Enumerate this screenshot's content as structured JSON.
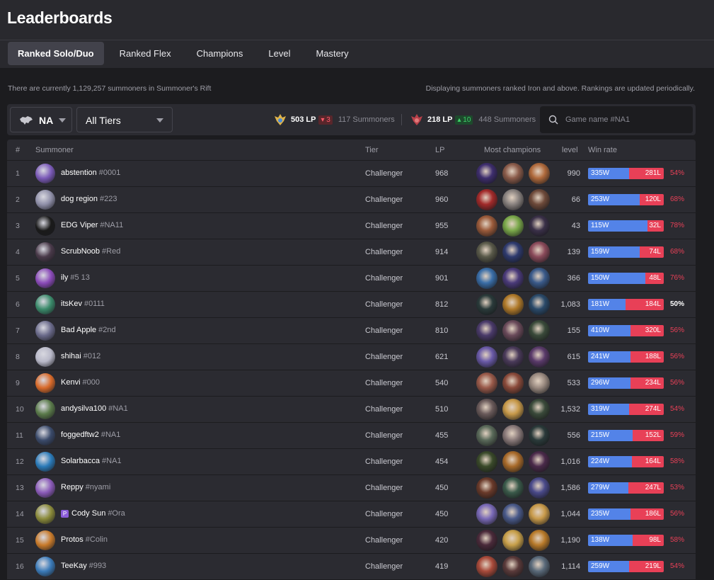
{
  "page": {
    "title": "Leaderboards"
  },
  "tabs": [
    {
      "label": "Ranked Solo/Duo",
      "active": true
    },
    {
      "label": "Ranked Flex",
      "active": false
    },
    {
      "label": "Champions",
      "active": false
    },
    {
      "label": "Level",
      "active": false
    },
    {
      "label": "Mastery",
      "active": false
    }
  ],
  "info": {
    "count_text": "There are currently 1,129,257 summoners in Summoner's Rift",
    "note": "Displaying summoners ranked Iron and above. Rankings are updated periodically."
  },
  "filters": {
    "region": "NA",
    "tier": "All Tiers",
    "search_placeholder": "Game name #NA1",
    "cutoffs": [
      {
        "lp": "503 LP",
        "delta": "3",
        "direction": "down",
        "summoners": "117 Summoners",
        "icon": "challenger-emblem-icon"
      },
      {
        "lp": "218 LP",
        "delta": "10",
        "direction": "up",
        "summoners": "448 Summoners",
        "icon": "grandmaster-emblem-icon"
      }
    ]
  },
  "table": {
    "headers": {
      "rank": "#",
      "summoner": "Summoner",
      "tier": "Tier",
      "lp": "LP",
      "champions": "Most champions",
      "level": "level",
      "winrate": "Win rate"
    },
    "rows": [
      {
        "rank": "1",
        "name": "abstention",
        "tag": "#0001",
        "tier": "Challenger",
        "lp": "968",
        "level": "990",
        "wins": "335W",
        "losses": "281L",
        "pct": "54%",
        "avatar_color": "#7b5ab8",
        "champs": [
          "#3e2e6e",
          "#8a5b4a",
          "#b06a3c"
        ]
      },
      {
        "rank": "2",
        "name": "dog region",
        "tag": "#223",
        "tier": "Challenger",
        "lp": "960",
        "level": "66",
        "wins": "253W",
        "losses": "120L",
        "pct": "68%",
        "avatar_color": "#8f8fa8",
        "champs": [
          "#a22a2a",
          "#8a8380",
          "#6e4a3a"
        ]
      },
      {
        "rank": "3",
        "name": "EDG Viper",
        "tag": "#NA11",
        "tier": "Challenger",
        "lp": "955",
        "level": "43",
        "wins": "115W",
        "losses": "32L",
        "pct": "78%",
        "avatar_color": "#1a1a1a",
        "champs": [
          "#9a5a3a",
          "#7aa84a",
          "#3a3048"
        ]
      },
      {
        "rank": "4",
        "name": "ScrubNoob",
        "tag": "#Red",
        "tier": "Challenger",
        "lp": "914",
        "level": "139",
        "wins": "159W",
        "losses": "74L",
        "pct": "68%",
        "avatar_color": "#4a3a4a",
        "champs": [
          "#5a5a4a",
          "#2e3a6e",
          "#8a4a5a"
        ]
      },
      {
        "rank": "5",
        "name": "ily",
        "tag": "#5 13",
        "tier": "Challenger",
        "lp": "901",
        "level": "366",
        "wins": "150W",
        "losses": "48L",
        "pct": "76%",
        "avatar_color": "#8a4ab8",
        "champs": [
          "#3a6ea8",
          "#4a3a7a",
          "#3a5a8a"
        ]
      },
      {
        "rank": "6",
        "name": "itsKev",
        "tag": "#0111",
        "tier": "Challenger",
        "lp": "812",
        "level": "1,083",
        "wins": "181W",
        "losses": "184L",
        "pct": "50%",
        "avatar_color": "#3a8a6a",
        "champs": [
          "#2a3a3a",
          "#b07a2a",
          "#2a4a6a"
        ]
      },
      {
        "rank": "7",
        "name": "Bad Apple",
        "tag": "#2nd",
        "tier": "Challenger",
        "lp": "810",
        "level": "155",
        "wins": "410W",
        "losses": "320L",
        "pct": "56%",
        "avatar_color": "#6a6a8a",
        "champs": [
          "#4a3a6a",
          "#6a4a5a",
          "#3a4a3a"
        ]
      },
      {
        "rank": "8",
        "name": "shihai",
        "tag": "#012",
        "tier": "Challenger",
        "lp": "621",
        "level": "615",
        "wins": "241W",
        "losses": "188L",
        "pct": "56%",
        "avatar_color": "#b8b8c8",
        "champs": [
          "#6a5aa8",
          "#4a3a5a",
          "#5a3a6a"
        ]
      },
      {
        "rank": "9",
        "name": "Kenvi",
        "tag": "#000",
        "tier": "Challenger",
        "lp": "540",
        "level": "533",
        "wins": "296W",
        "losses": "234L",
        "pct": "56%",
        "avatar_color": "#d86a2a",
        "champs": [
          "#9a5a4a",
          "#8a4a3a",
          "#9a8a80"
        ]
      },
      {
        "rank": "10",
        "name": "andysilva100",
        "tag": "#NA1",
        "tier": "Challenger",
        "lp": "510",
        "level": "1,532",
        "wins": "319W",
        "losses": "274L",
        "pct": "54%",
        "avatar_color": "#5a7a4a",
        "champs": [
          "#6a5a5a",
          "#c89a4a",
          "#3a4a3a"
        ]
      },
      {
        "rank": "11",
        "name": "foggedftw2",
        "tag": "#NA1",
        "tier": "Challenger",
        "lp": "455",
        "level": "556",
        "wins": "215W",
        "losses": "152L",
        "pct": "59%",
        "avatar_color": "#3a4a6a",
        "champs": [
          "#5a6a5a",
          "#8a7a7a",
          "#2a3a3a"
        ]
      },
      {
        "rank": "12",
        "name": "Solarbacca",
        "tag": "#NA1",
        "tier": "Challenger",
        "lp": "454",
        "level": "1,016",
        "wins": "224W",
        "losses": "164L",
        "pct": "58%",
        "avatar_color": "#2a7ab8",
        "champs": [
          "#3a4a2a",
          "#a86a2a",
          "#4a2a4a"
        ]
      },
      {
        "rank": "13",
        "name": "Reppy",
        "tag": "#nyami",
        "tier": "Challenger",
        "lp": "450",
        "level": "1,586",
        "wins": "279W",
        "losses": "247L",
        "pct": "53%",
        "avatar_color": "#8a5ab8",
        "champs": [
          "#6a3a2a",
          "#3a5a4a",
          "#4a4a8a"
        ]
      },
      {
        "rank": "14",
        "name": "Cody Sun",
        "tag": "#Ora",
        "tier": "Challenger",
        "lp": "450",
        "level": "1,044",
        "wins": "235W",
        "losses": "186L",
        "pct": "56%",
        "avatar_color": "#8a8a3a",
        "badge": "P",
        "champs": [
          "#7a6ab8",
          "#4a5a8a",
          "#c89a4a"
        ]
      },
      {
        "rank": "15",
        "name": "Protos",
        "tag": "#Colin",
        "tier": "Challenger",
        "lp": "420",
        "level": "1,190",
        "wins": "138W",
        "losses": "98L",
        "pct": "58%",
        "avatar_color": "#c87a2a",
        "champs": [
          "#4a2a3a",
          "#c8a04a",
          "#b87a2a"
        ]
      },
      {
        "rank": "16",
        "name": "TeeKay",
        "tag": "#993",
        "tier": "Challenger",
        "lp": "419",
        "level": "1,114",
        "wins": "259W",
        "losses": "219L",
        "pct": "54%",
        "avatar_color": "#3a7ab8",
        "champs": [
          "#a84a3a",
          "#5a3a3a",
          "#5a6a7a"
        ]
      }
    ]
  },
  "colors": {
    "win": "#5383e8",
    "loss": "#e84057",
    "even": "#ffffff",
    "accent": "#42424b"
  }
}
